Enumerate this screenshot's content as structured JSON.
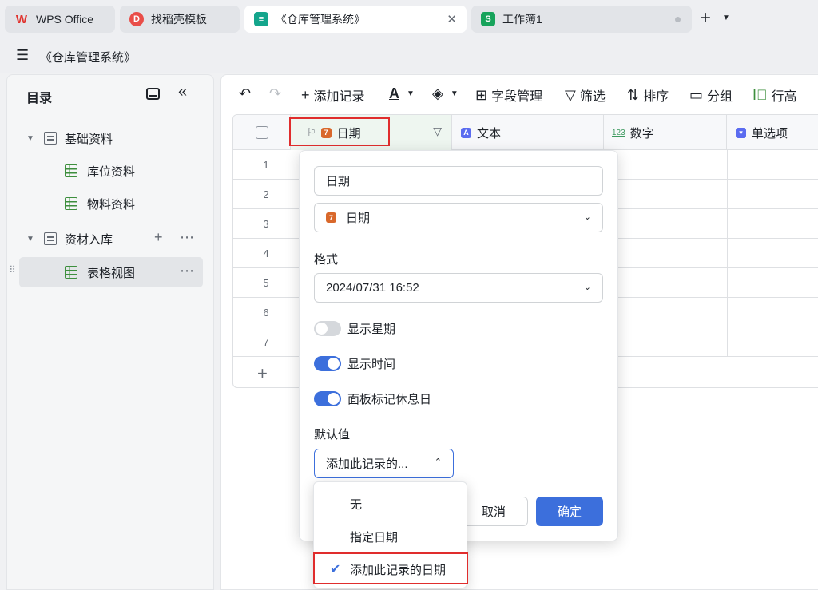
{
  "tabs": [
    {
      "label": "WPS Office",
      "icon": "wps-icon",
      "color": "#e0332e"
    },
    {
      "label": "找稻壳模板",
      "icon": "docer-icon",
      "color": "#e94d48"
    },
    {
      "label": "《仓库管理系统》",
      "icon": "multidim-table-icon",
      "color": "#14a58c",
      "close": "✕"
    },
    {
      "label": "工作簿1",
      "icon": "spreadsheet-icon",
      "color": "#17a35b"
    }
  ],
  "doc_title": "《仓库管理系统》",
  "sidebar": {
    "title": "目录",
    "items": [
      {
        "label": "基础资料",
        "type": "folder"
      },
      {
        "label": "库位资料",
        "type": "sheet"
      },
      {
        "label": "物料资料",
        "type": "sheet"
      },
      {
        "label": "资材入库",
        "type": "folder"
      },
      {
        "label": "表格视图",
        "type": "sheet",
        "selected": true
      }
    ]
  },
  "toolbar": {
    "add_record": "添加记录",
    "field_manage": "字段管理",
    "filter": "筛选",
    "sort": "排序",
    "group": "分组",
    "row_height": "行高"
  },
  "grid": {
    "columns": [
      {
        "label": "日期",
        "icon": "date-field-icon",
        "color": "#d9682b"
      },
      {
        "label": "文本",
        "icon": "text-field-icon",
        "color": "#5b6cf0"
      },
      {
        "label": "数字",
        "icon": "number-field-icon",
        "color": "#3d9a5f"
      },
      {
        "label": "单选项",
        "icon": "single-select-icon",
        "color": "#5b6cf0"
      }
    ],
    "row_numbers": [
      "1",
      "2",
      "3",
      "4",
      "5",
      "6",
      "7"
    ]
  },
  "field_popup": {
    "field_name": "日期",
    "field_type": "日期",
    "format_label": "格式",
    "format_value": "2024/07/31 16:52",
    "show_weekday": {
      "label": "显示星期",
      "on": false
    },
    "show_time": {
      "label": "显示时间",
      "on": true
    },
    "mark_holidays": {
      "label": "面板标记休息日",
      "on": true
    },
    "default_label": "默认值",
    "default_value": "添加此记录的...",
    "cancel": "取消",
    "confirm": "确定"
  },
  "default_menu": {
    "options": [
      "无",
      "指定日期",
      "添加此记录的日期"
    ],
    "selected": "添加此记录的日期"
  },
  "colors": {
    "accent": "#3c6fdc",
    "highlight": "#e02d2d"
  }
}
